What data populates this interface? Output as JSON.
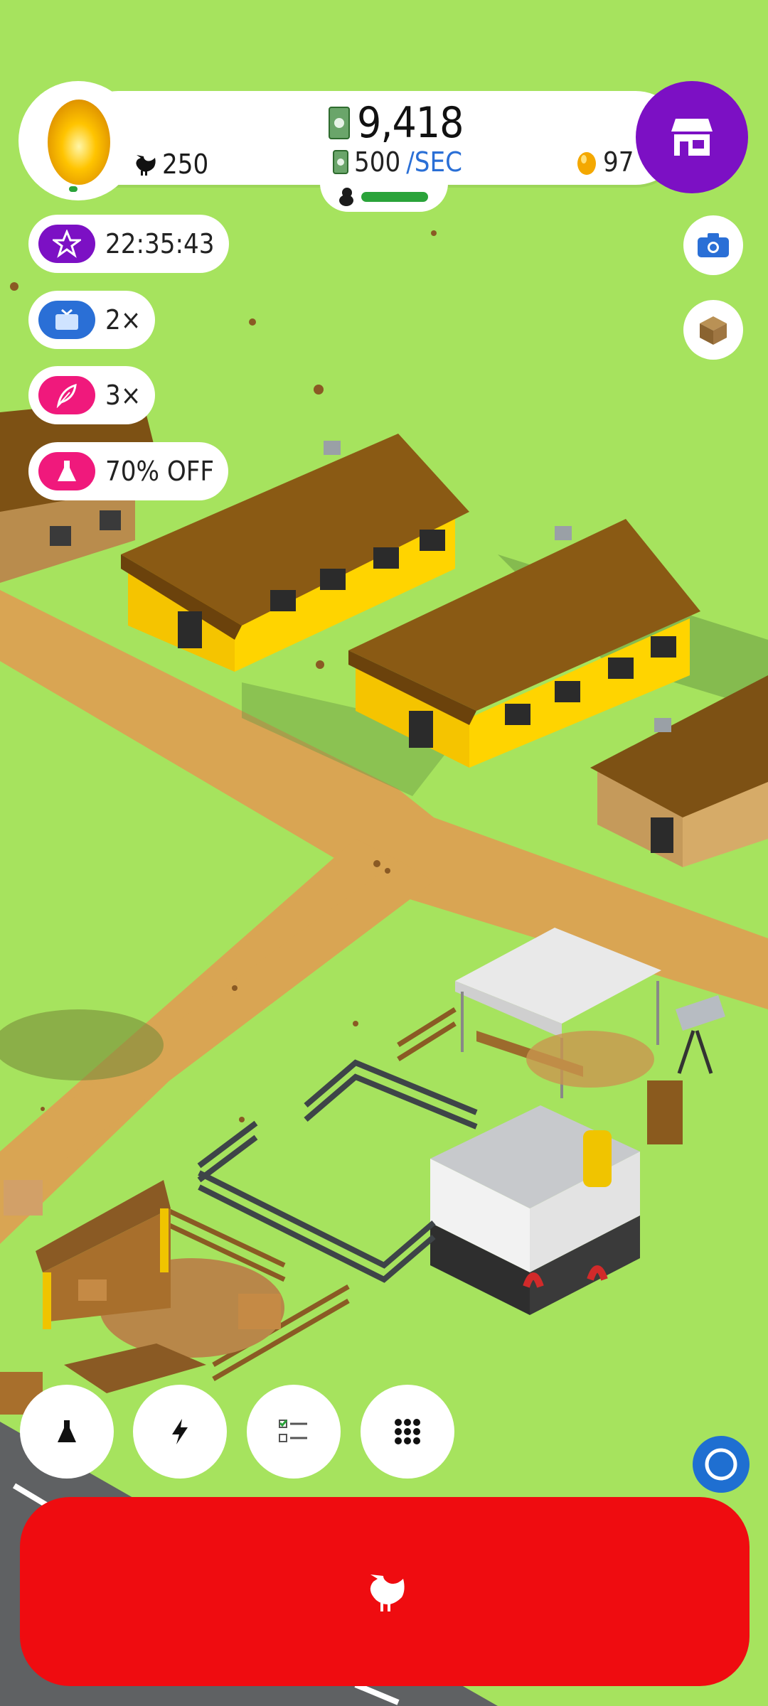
{
  "header": {
    "chicken_count": "250",
    "cash": "9,418",
    "rate_value": "500",
    "rate_unit": "/SEC",
    "golden_eggs": "97"
  },
  "boosts": [
    {
      "label": "22:35:43",
      "icon": "star-icon",
      "color": "#7c10c4"
    },
    {
      "label": "2×",
      "icon": "tv-icon",
      "color": "#2a6fd6"
    },
    {
      "label": "3×",
      "icon": "feather-icon",
      "color": "#f0197c"
    },
    {
      "label": "70% OFF",
      "icon": "flask-icon",
      "color": "#f0197c"
    }
  ],
  "icons": {
    "shop": "shop-icon",
    "camera": "camera-icon",
    "package": "box-icon",
    "research": "flask-icon",
    "boosts": "lightning-icon",
    "missions": "checklist-icon",
    "menu": "grid-icon",
    "assist": "circle-icon",
    "hatch": "chicken-icon"
  },
  "colors": {
    "grass": "#a6e35e",
    "shop": "#7c10c4",
    "hatch": "#ef0c10",
    "progress": "#2aa33a",
    "accent_blue": "#2a6fd6"
  }
}
